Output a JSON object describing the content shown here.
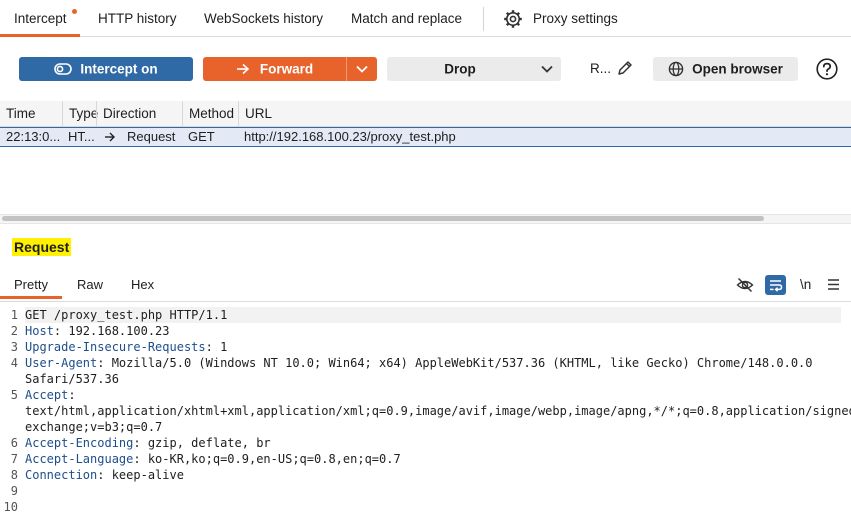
{
  "tabs": {
    "intercept": "Intercept",
    "http_history": "HTTP history",
    "websockets_history": "WebSockets history",
    "match_replace": "Match and replace",
    "proxy_settings": "Proxy settings"
  },
  "toolbar": {
    "intercept_label": "Intercept on",
    "forward_label": "Forward",
    "drop_label": "Drop",
    "r_label": "R...",
    "open_browser_label": "Open browser"
  },
  "table": {
    "headers": [
      "Time",
      "Type",
      "Direction",
      "Method",
      "URL"
    ],
    "rows": [
      {
        "time": "22:13:0...",
        "type": "HT...",
        "direction": "Request",
        "method": "GET",
        "url": "http://192.168.100.23/proxy_test.php"
      }
    ]
  },
  "request": {
    "title": "Request",
    "subtabs": [
      "Pretty",
      "Raw",
      "Hex"
    ],
    "newline_toggle": "\\n",
    "lines": [
      {
        "num": "1",
        "key": "",
        "text": "GET /proxy_test.php HTTP/1.1"
      },
      {
        "num": "2",
        "key": "Host",
        "text": ": 192.168.100.23"
      },
      {
        "num": "3",
        "key": "Upgrade-Insecure-Requests",
        "text": ": 1"
      },
      {
        "num": "4",
        "key": "User-Agent",
        "text": ": Mozilla/5.0 (Windows NT 10.0; Win64; x64) AppleWebKit/537.36 (KHTML, like Gecko) Chrome/148.0.0.0"
      },
      {
        "num": "",
        "key": "",
        "text": "Safari/537.36"
      },
      {
        "num": "5",
        "key": "Accept",
        "text": ":"
      },
      {
        "num": "",
        "key": "",
        "text": "text/html,application/xhtml+xml,application/xml;q=0.9,image/avif,image/webp,image/apng,*/*;q=0.8,application/signed-"
      },
      {
        "num": "",
        "key": "",
        "text": "exchange;v=b3;q=0.7"
      },
      {
        "num": "6",
        "key": "Accept-Encoding",
        "text": ": gzip, deflate, br"
      },
      {
        "num": "7",
        "key": "Accept-Language",
        "text": ": ko-KR,ko;q=0.9,en-US;q=0.8,en;q=0.7"
      },
      {
        "num": "8",
        "key": "Connection",
        "text": ": keep-alive"
      },
      {
        "num": "9",
        "key": "",
        "text": ""
      },
      {
        "num": "10",
        "key": "",
        "text": ""
      }
    ]
  },
  "colors": {
    "accent_orange": "#e8632b",
    "accent_blue": "#2f6aa6",
    "highlight_yellow": "#fff100"
  }
}
